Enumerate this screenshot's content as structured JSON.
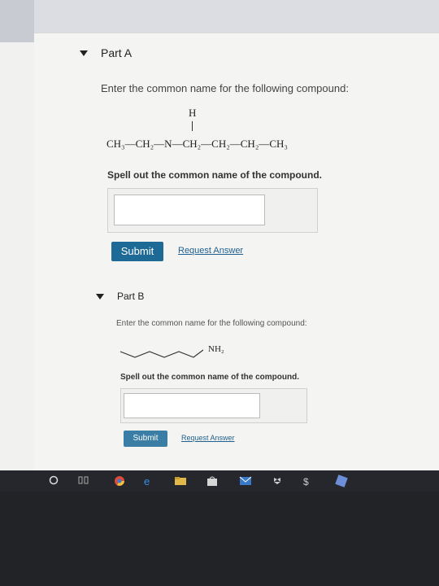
{
  "partA": {
    "title": "Part A",
    "prompt": "Enter the common name for the following compound:",
    "formula_h": "H",
    "formula_line": "CH₃—CH₂—N—CH₂—CH₂—CH₂—CH₃",
    "instruction": "Spell out the common name of the compound.",
    "answer_value": "",
    "submit_label": "Submit",
    "request_label": "Request Answer"
  },
  "partB": {
    "title": "Part B",
    "prompt": "Enter the common name for the following compound:",
    "formula_group": "NH₂",
    "instruction": "Spell out the common name of the compound.",
    "answer_value": "",
    "submit_label": "Submit",
    "request_label": "Request Answer"
  },
  "taskbar": {
    "icons": [
      "start-icon",
      "task-view-icon",
      "chrome-icon",
      "edge-icon",
      "file-explorer-icon",
      "store-icon",
      "mail-icon",
      "dropbox-icon",
      "app-icon",
      "slack-icon"
    ]
  },
  "colors": {
    "button": "#1d6a97",
    "link": "#1f5f8f",
    "taskbar": "#25272c"
  }
}
